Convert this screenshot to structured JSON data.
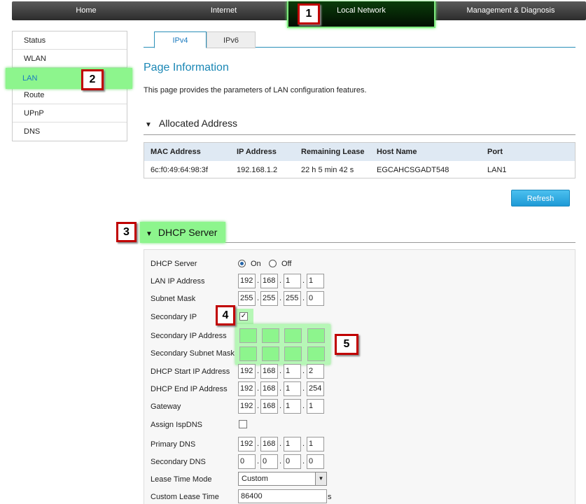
{
  "nav": {
    "home": "Home",
    "internet": "Internet",
    "local": "Local Network",
    "mgmt": "Management & Diagnosis"
  },
  "callouts": [
    "1",
    "2",
    "3",
    "4",
    "5"
  ],
  "sidebar": {
    "items": [
      "Status",
      "WLAN",
      "LAN",
      "Route",
      "UPnP",
      "DNS"
    ]
  },
  "tabs": {
    "ipv4": "IPv4",
    "ipv6": "IPv6"
  },
  "page": {
    "title": "Page Information",
    "desc": "This page provides the parameters of LAN configuration features."
  },
  "allocated": {
    "heading": "Allocated Address",
    "columns": [
      "MAC Address",
      "IP Address",
      "Remaining Lease",
      "Host Name",
      "Port"
    ],
    "row": [
      "6c:f0:49:64:98:3f",
      "192.168.1.2",
      "22 h 5 min 42 s",
      "EGCAHCSGADT548",
      "LAN1"
    ],
    "refresh": "Refresh"
  },
  "dhcp": {
    "heading": "DHCP Server",
    "labels": {
      "server": "DHCP Server",
      "lanip": "LAN IP Address",
      "mask": "Subnet Mask",
      "secip": "Secondary IP",
      "secipaddr": "Secondary IP Address",
      "secmask": "Secondary Subnet Mask",
      "start": "DHCP Start IP Address",
      "end": "DHCP End IP Address",
      "gateway": "Gateway",
      "ispdns": "Assign IspDNS",
      "pdns": "Primary DNS",
      "sdns": "Secondary DNS",
      "leasemode": "Lease Time Mode",
      "leasetime": "Custom Lease Time"
    },
    "on_label": "On",
    "off_label": "Off",
    "lanip": [
      "192",
      "168",
      "1",
      "1"
    ],
    "mask": [
      "255",
      "255",
      "255",
      "0"
    ],
    "start": [
      "192",
      "168",
      "1",
      "2"
    ],
    "end": [
      "192",
      "168",
      "1",
      "254"
    ],
    "gateway": [
      "192",
      "168",
      "1",
      "1"
    ],
    "pdns": [
      "192",
      "168",
      "1",
      "1"
    ],
    "sdns": [
      "0",
      "0",
      "0",
      "0"
    ],
    "secip_checked": "✓",
    "leasemode_value": "Custom",
    "leasetime_value": "86400",
    "leasetime_unit": "s"
  },
  "colors": {
    "highlight_green": "#8df58d",
    "callout_border": "#c00000",
    "accent_blue": "#1a87b5"
  }
}
